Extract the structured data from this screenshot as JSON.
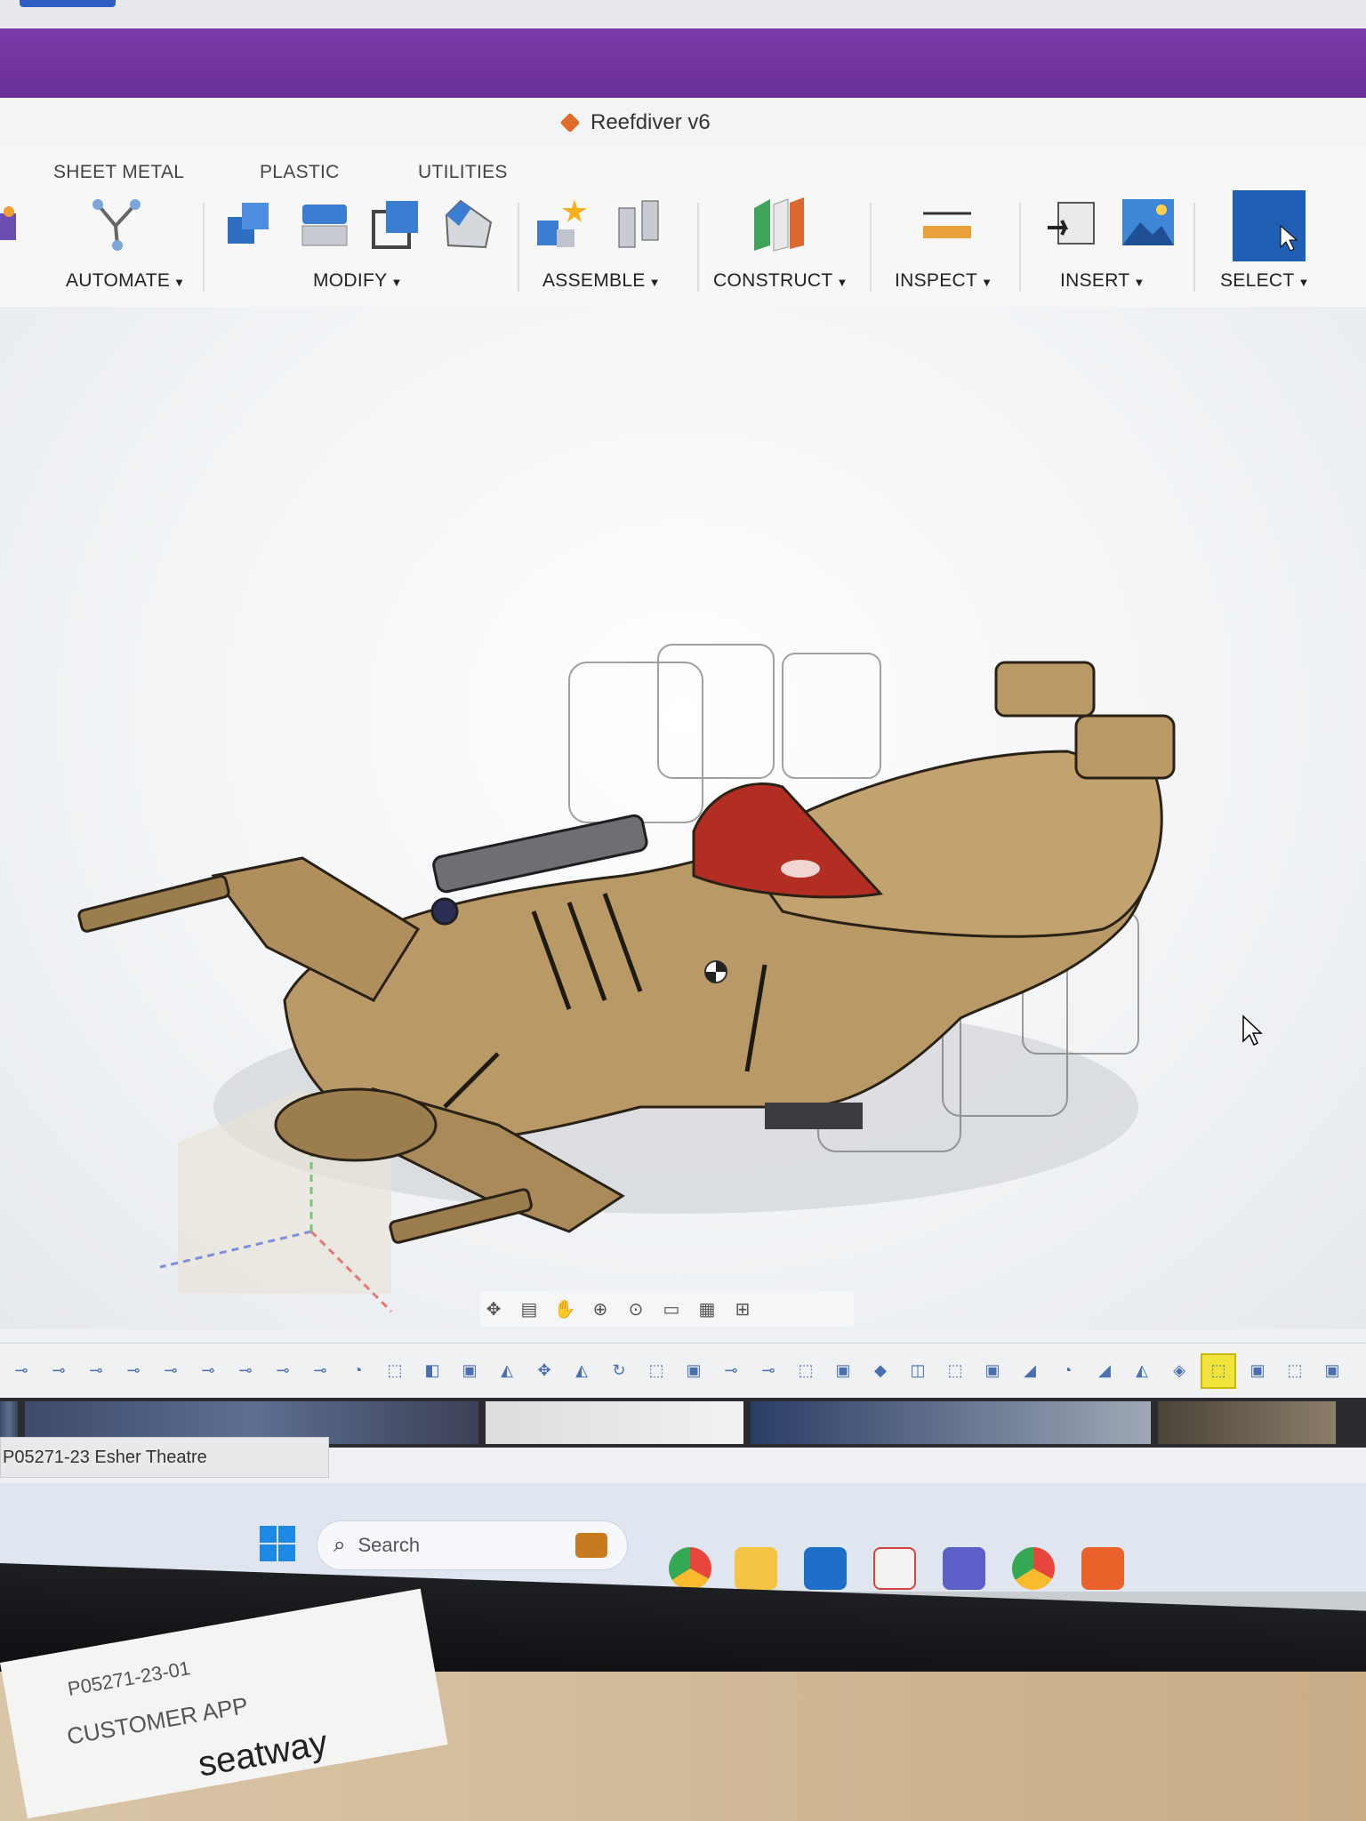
{
  "app": {
    "document_title": "Reefdiver v6"
  },
  "ribbon": {
    "tabs": [
      "SHEET METAL",
      "PLASTIC",
      "UTILITIES"
    ],
    "groups": {
      "automate": "AUTOMATE",
      "modify": "MODIFY",
      "assemble": "ASSEMBLE",
      "construct": "CONSTRUCT",
      "inspect": "INSPECT",
      "insert": "INSERT",
      "select": "SELECT"
    },
    "accent_colors": {
      "ribbon_purple": "#6a2f98",
      "tool_blue": "#2f6fc2",
      "select_blue": "#1f5fb4",
      "timeline_selected": "#f0e43a"
    }
  },
  "viewport": {
    "model_description_icon": "spaceship-model",
    "body_color": "#b99a66",
    "canopy_color": "#b22e22"
  },
  "navbar": {
    "icons": [
      "orbit-icon",
      "look-at-icon",
      "pan-icon",
      "zoom-icon",
      "fit-icon",
      "display-settings-icon",
      "grid-icon",
      "viewports-icon"
    ]
  },
  "timeline": {
    "item_count_visible": 36,
    "selected_index": 32
  },
  "file_tab": {
    "label": "P05271-23 Esher Theatre"
  },
  "taskbar": {
    "search_placeholder": "Search",
    "apps": [
      "windows-start-icon",
      "briefcase-icon",
      "chrome-icon",
      "file-explorer-icon",
      "outlook-icon",
      "snipping-tool-icon",
      "teams-icon",
      "chrome-icon",
      "fusion-360-icon"
    ]
  },
  "desk_paper": {
    "lines": [
      "CUSTOMER APP",
      "seatway",
      "P05271-23-01"
    ]
  }
}
